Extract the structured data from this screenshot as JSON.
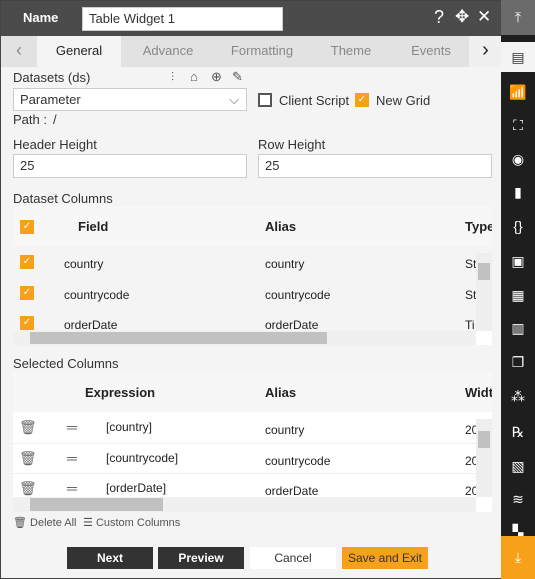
{
  "header": {
    "name_label": "Name",
    "name_value": "Table Widget 1"
  },
  "tabs": [
    "General",
    "Advance",
    "Formatting",
    "Theme",
    "Events"
  ],
  "datasets": {
    "label": "Datasets (ds)",
    "value": "Parameter",
    "client_script_label": "Client Script",
    "client_script_checked": false,
    "new_grid_label": "New Grid",
    "new_grid_checked": true,
    "path_label": "Path :",
    "path_value": "/"
  },
  "sizes": {
    "header_height_label": "Header Height",
    "header_height": "25",
    "row_height_label": "Row Height",
    "row_height": "25"
  },
  "dataset_columns": {
    "title": "Dataset Columns",
    "headers": [
      "Field",
      "Alias",
      "Type"
    ],
    "rows": [
      {
        "field": "country",
        "alias": "country",
        "type": "St"
      },
      {
        "field": "countrycode",
        "alias": "countrycode",
        "type": "St"
      },
      {
        "field": "orderDate",
        "alias": "orderDate",
        "type": "Ti"
      }
    ]
  },
  "selected_columns": {
    "title": "Selected Columns",
    "headers": [
      "Expression",
      "Alias",
      "Widt"
    ],
    "rows": [
      {
        "expression": "[country]",
        "alias": "country",
        "width": "20"
      },
      {
        "expression": "[countrycode]",
        "alias": "countrycode",
        "width": "20"
      },
      {
        "expression": "[orderDate]",
        "alias": "orderDate",
        "width": "20"
      }
    ]
  },
  "actions": {
    "delete_all": "Delete All",
    "custom_columns": "Custom Columns"
  },
  "buttons": {
    "next": "Next",
    "preview": "Preview",
    "cancel": "Cancel",
    "save": "Save and Exit"
  },
  "colors": {
    "accent": "#f7a11a",
    "dark": "#333333",
    "header": "#4b4b4b"
  }
}
